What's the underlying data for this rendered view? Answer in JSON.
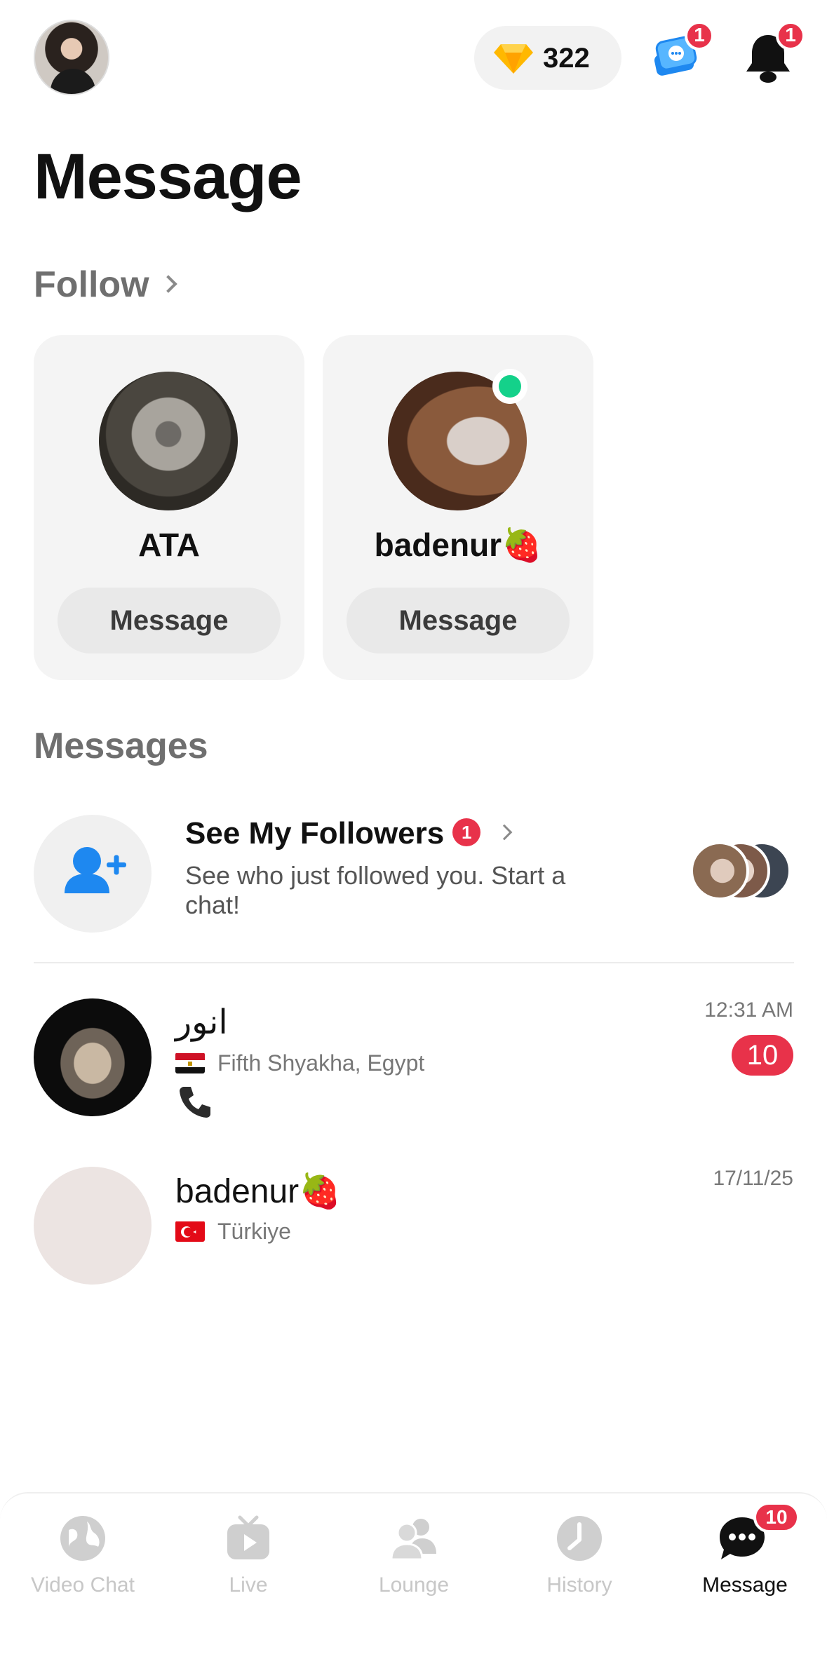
{
  "header": {
    "gems": "322",
    "chat_badge": "1",
    "bell_badge": "1",
    "title": "Message"
  },
  "follow": {
    "heading": "Follow",
    "cards": [
      {
        "name": "ATA",
        "button": "Message"
      },
      {
        "name": "badenur🍓",
        "button": "Message"
      }
    ]
  },
  "messages": {
    "heading": "Messages",
    "followers": {
      "title": "See My Followers",
      "badge": "1",
      "subtitle": "See who just followed you. Start a chat!"
    },
    "chats": [
      {
        "name": "انور",
        "location": "Fifth Shyakha, Egypt",
        "time": "12:31 AM",
        "unread": "10",
        "preview_icon": "phone-icon"
      },
      {
        "name": "badenur🍓",
        "location": "Türkiye",
        "time": "17/11/25"
      }
    ]
  },
  "tabbar": {
    "tabs": [
      {
        "label": "Video Chat",
        "icon": "globe-icon"
      },
      {
        "label": "Live",
        "icon": "tv-icon"
      },
      {
        "label": "Lounge",
        "icon": "people-icon"
      },
      {
        "label": "History",
        "icon": "clock-icon"
      },
      {
        "label": "Message",
        "icon": "chat-bubble-icon",
        "badge": "10",
        "active": true
      }
    ]
  },
  "colors": {
    "badge_red": "#e8324a",
    "online_green": "#14d18a",
    "accent_blue": "#1e88f0"
  }
}
